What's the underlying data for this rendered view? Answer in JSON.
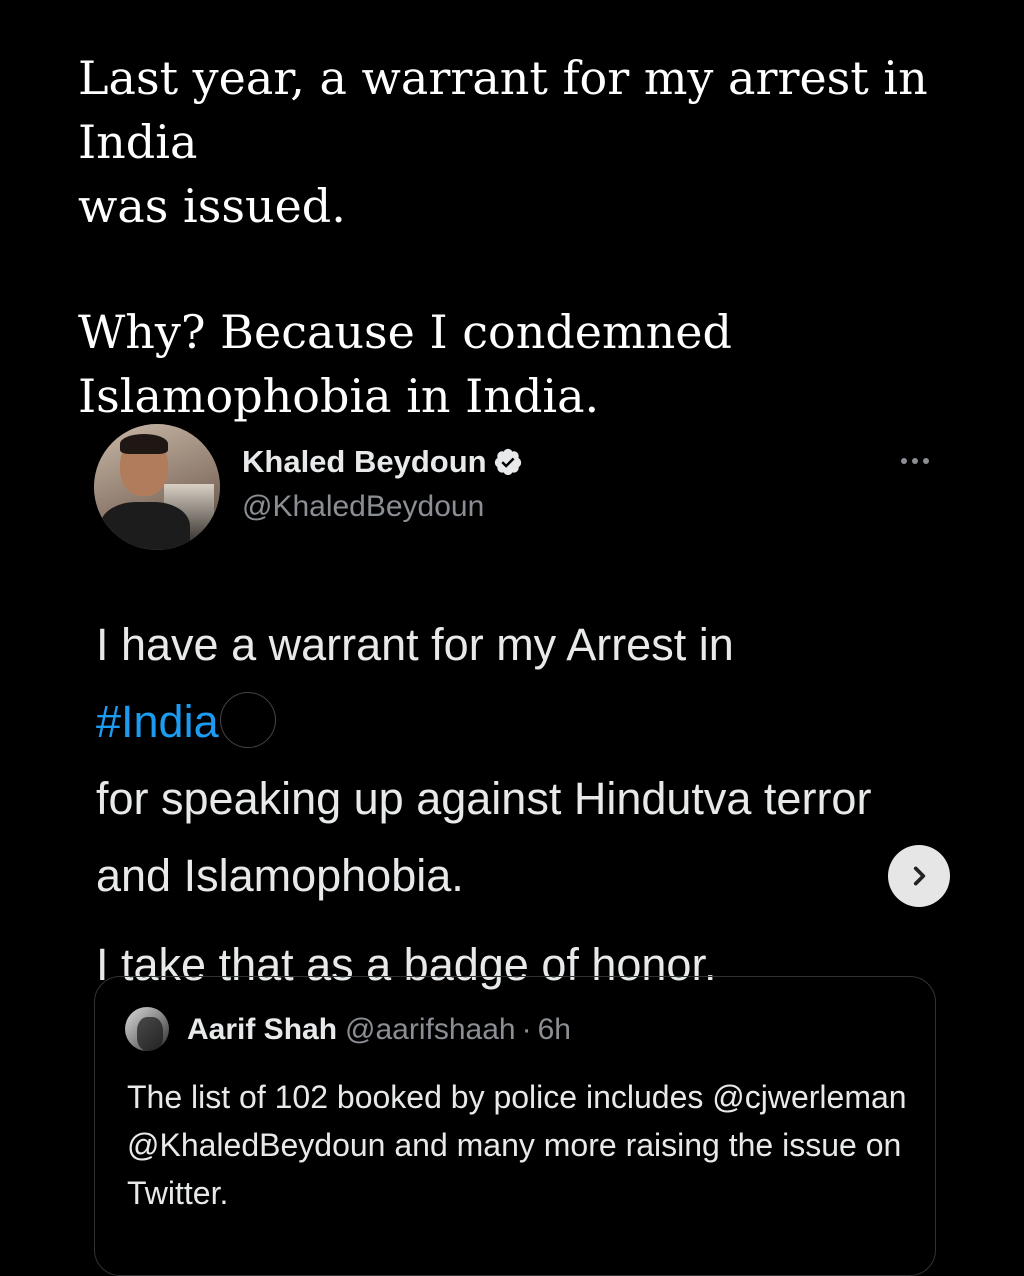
{
  "caption": {
    "line1_pre": "Last year, a warrant for my arrest in India",
    "line1_post": "was issued.",
    "line2": "Why? Because I condemned Islamophobia in India."
  },
  "tweet": {
    "author_name": "Khaled Beydoun",
    "author_handle": "@KhaledBeydoun",
    "verified": true,
    "text_line1_pre": "I have a warrant for my Arrest in",
    "hashtag": "#India",
    "text_line1_post": "for speaking up against Hindutva terror and Islamophobia.",
    "text_line2": "I take that as a badge of honor."
  },
  "quoted_tweet": {
    "author_name": "Aarif Shah",
    "author_handle": "@aarifshaah",
    "separator": "·",
    "time": "6h",
    "text": "The list of 102 booked by police includes @cjwerleman @KhaledBeydoun and many more raising the issue on Twitter."
  },
  "icons": {
    "flag": "india-flag-icon",
    "verified": "verified-badge-icon",
    "more": "more-options-icon",
    "next": "chevron-right-icon"
  },
  "colors": {
    "background": "#000000",
    "text_primary": "#e7e9ea",
    "text_secondary": "#8b8f94",
    "link": "#1d9bf0",
    "border": "#2f3336"
  }
}
